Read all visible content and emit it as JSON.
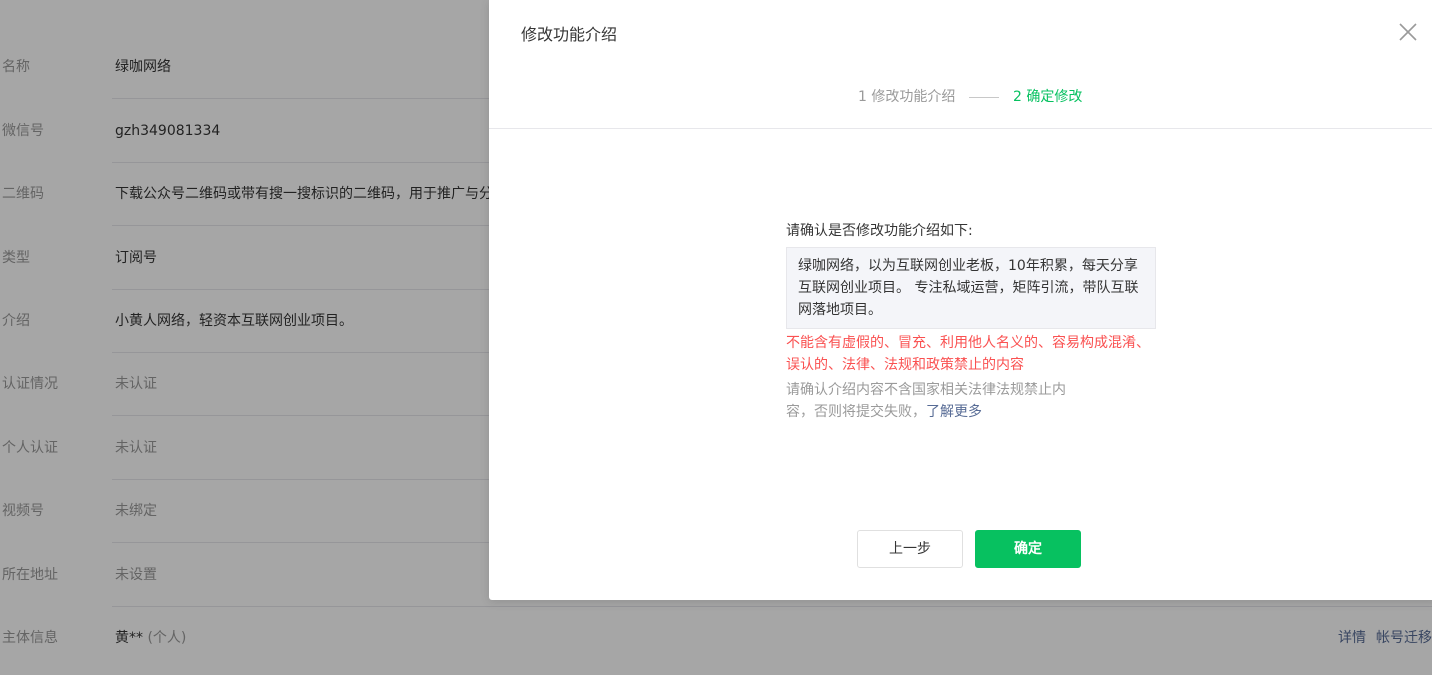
{
  "background": {
    "rows": [
      {
        "label": "名称",
        "value": "绿咖网络"
      },
      {
        "label": "微信号",
        "value": "gzh349081334"
      },
      {
        "label": "二维码",
        "value": "下载公众号二维码或带有搜一搜标识的二维码，用于推广与分"
      },
      {
        "label": "类型",
        "value": "订阅号"
      },
      {
        "label": "介绍",
        "value": "小黄人网络，轻资本互联网创业项目。"
      },
      {
        "label": "认证情况",
        "value": "未认证"
      },
      {
        "label": "个人认证",
        "value": "未认证"
      },
      {
        "label": "视频号",
        "value": "未绑定"
      },
      {
        "label": "所在地址",
        "value": "未设置"
      },
      {
        "label": "主体信息",
        "value": "黄**",
        "suffix": " (个人)"
      }
    ],
    "subject_actions": {
      "detail": "详情",
      "migrate": "帐号迁移"
    }
  },
  "dialog": {
    "title": "修改功能介绍",
    "close_icon": "close-icon",
    "steps": [
      {
        "label": "1 修改功能介绍",
        "state": "done"
      },
      {
        "label": "2 确定修改",
        "state": "current"
      }
    ],
    "question": "请确认是否修改功能介绍如下:",
    "intro_text": "绿咖网络，以为互联网创业老板，10年积累，每天分享互联网创业项目。 专注私域运营，矩阵引流，带队互联网落地项目。",
    "warning_red": "不能含有虚假的、冒充、利用他人名义的、容易构成混淆、误认的、法律、法规和政策禁止的内容",
    "warning_grey": "请确认介绍内容不含国家相关法律法规禁止内容，否则将提交失败，",
    "learn_more": "了解更多",
    "buttons": {
      "prev": "上一步",
      "confirm": "确定"
    }
  },
  "colors": {
    "accent": "#07c160",
    "warning": "#fa5151",
    "link": "#576b95",
    "overlay": "rgba(0,0,0,0.35)"
  }
}
